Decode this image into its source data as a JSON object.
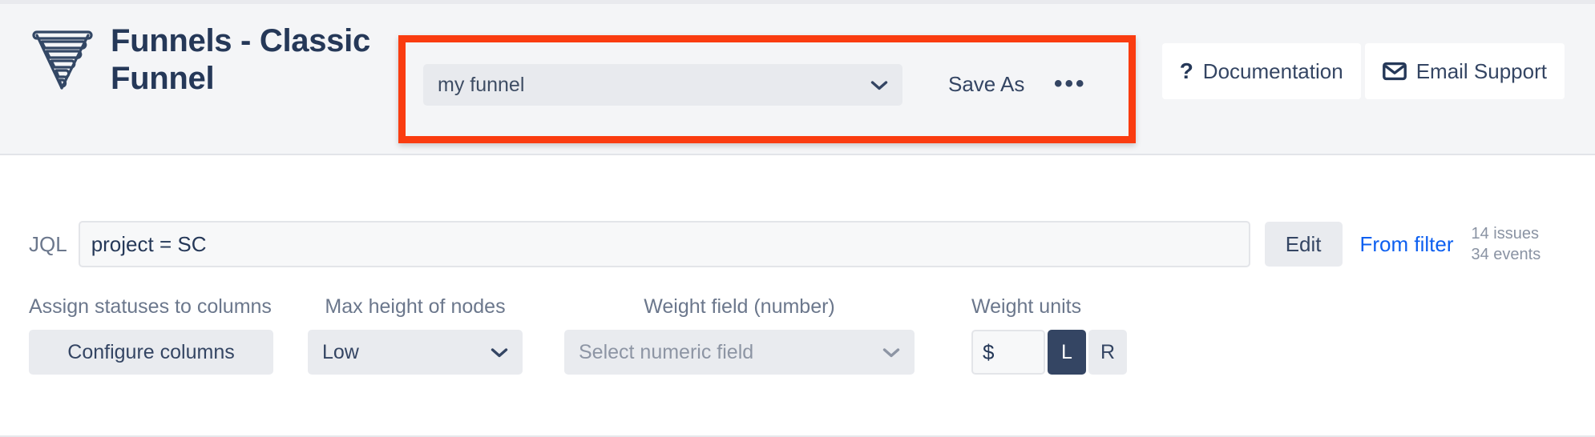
{
  "header": {
    "logo_icon": "funnel-icon",
    "title": "Funnels - Classic Funnel",
    "funnel_select": {
      "value": "my funnel",
      "chevron_icon": "chevron-down-icon"
    },
    "save_as_label": "Save As",
    "more_label": "•••",
    "documentation": {
      "icon": "question-mark-icon",
      "label": "Documentation"
    },
    "email_support": {
      "icon": "envelope-icon",
      "label": "Email Support"
    },
    "highlight_color": "#fa3c10",
    "background_color": "#f4f5f7"
  },
  "jql": {
    "label": "JQL",
    "value": "project = SC",
    "placeholder": "",
    "edit_label": "Edit",
    "from_filter_label": "From filter",
    "from_filter_color": "#0c5ff0",
    "issues_count": "14 issues",
    "events_count": "34 events"
  },
  "controls": {
    "assign_statuses": {
      "label": "Assign statuses to columns",
      "button_label": "Configure columns"
    },
    "max_height": {
      "label": "Max height of nodes",
      "value": "Low",
      "chevron_icon": "chevron-down-icon"
    },
    "weight_field": {
      "label": "Weight field (number)",
      "placeholder": "Select numeric field",
      "chevron_icon": "chevron-down-icon"
    },
    "weight_units": {
      "label": "Weight units",
      "currency_value": "$",
      "left_label": "L",
      "right_label": "R",
      "selected": "L",
      "selected_color": "#344563"
    }
  }
}
